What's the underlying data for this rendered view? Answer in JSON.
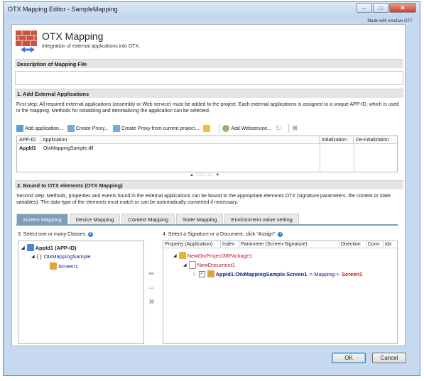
{
  "window": {
    "title": "OTX Mapping Editor - SampleMapping",
    "brand": "Made with emotive OTF"
  },
  "header": {
    "title": "OTX Mapping",
    "subtitle": "Integration of external applications into OTX."
  },
  "sections": {
    "description": "Description of Mapping File",
    "external_apps": "1. Add External Applications",
    "bound": "2. Bound to OTX elements (OTX Mapping)"
  },
  "step1_text": "First step: All required external applications (assembly or Web service) must be added to the project. Each external applications is assigned to a unique APP-ID, which is used in the mapping. Methods for initializing and deinitializing the application can be selected.",
  "toolbar": {
    "add_application": "Add application...",
    "create_proxy": "Create Proxy...",
    "create_proxy_current": "Create Proxy from current project...",
    "add_webservice": "Add Webservice..."
  },
  "app_grid": {
    "columns": [
      "APP-ID",
      "Application",
      "Intialization",
      "De-Intialization"
    ],
    "rows": [
      {
        "app_id": "AppId1",
        "application": "OtxMappingSample.dll"
      }
    ]
  },
  "step2_text": "Second step: Methods, properties and events found in the external applications can be bound to the appropriate elements OTX (signature parameters, the context or state variables). The data type of the elements must match or can be automatically converted if necessary.",
  "tabs": [
    "Screen Mapping",
    "Device Mapping",
    "Context Mapping",
    "State Mapping",
    "Environment value setting"
  ],
  "left_label": "3. Select one or many Classes.",
  "left_tree": {
    "root": "AppId1 (APP-ID)",
    "class": "OtxMappingSample",
    "member": "Screen1"
  },
  "right_label": "4. Select a Signature or a Document, click \"Assign\".",
  "right_columns": [
    "Property (Application)",
    "Index",
    "Parameter (Screen-Signature)",
    "Direction",
    "Conv",
    "Idx"
  ],
  "right_tree": {
    "package": "NewOtxProject38Package1",
    "document": "NewDocument1",
    "mapping_source": "AppId1.OtxMappingSample.Screen1",
    "mapping_arrow": "<-Mapping->",
    "mapping_target": "Screen1"
  },
  "buttons": {
    "ok": "OK",
    "cancel": "Cancel"
  },
  "colors": {
    "accent": "#7f9db9",
    "tree_text": "#1a237e",
    "red_text": "#c0141e"
  }
}
